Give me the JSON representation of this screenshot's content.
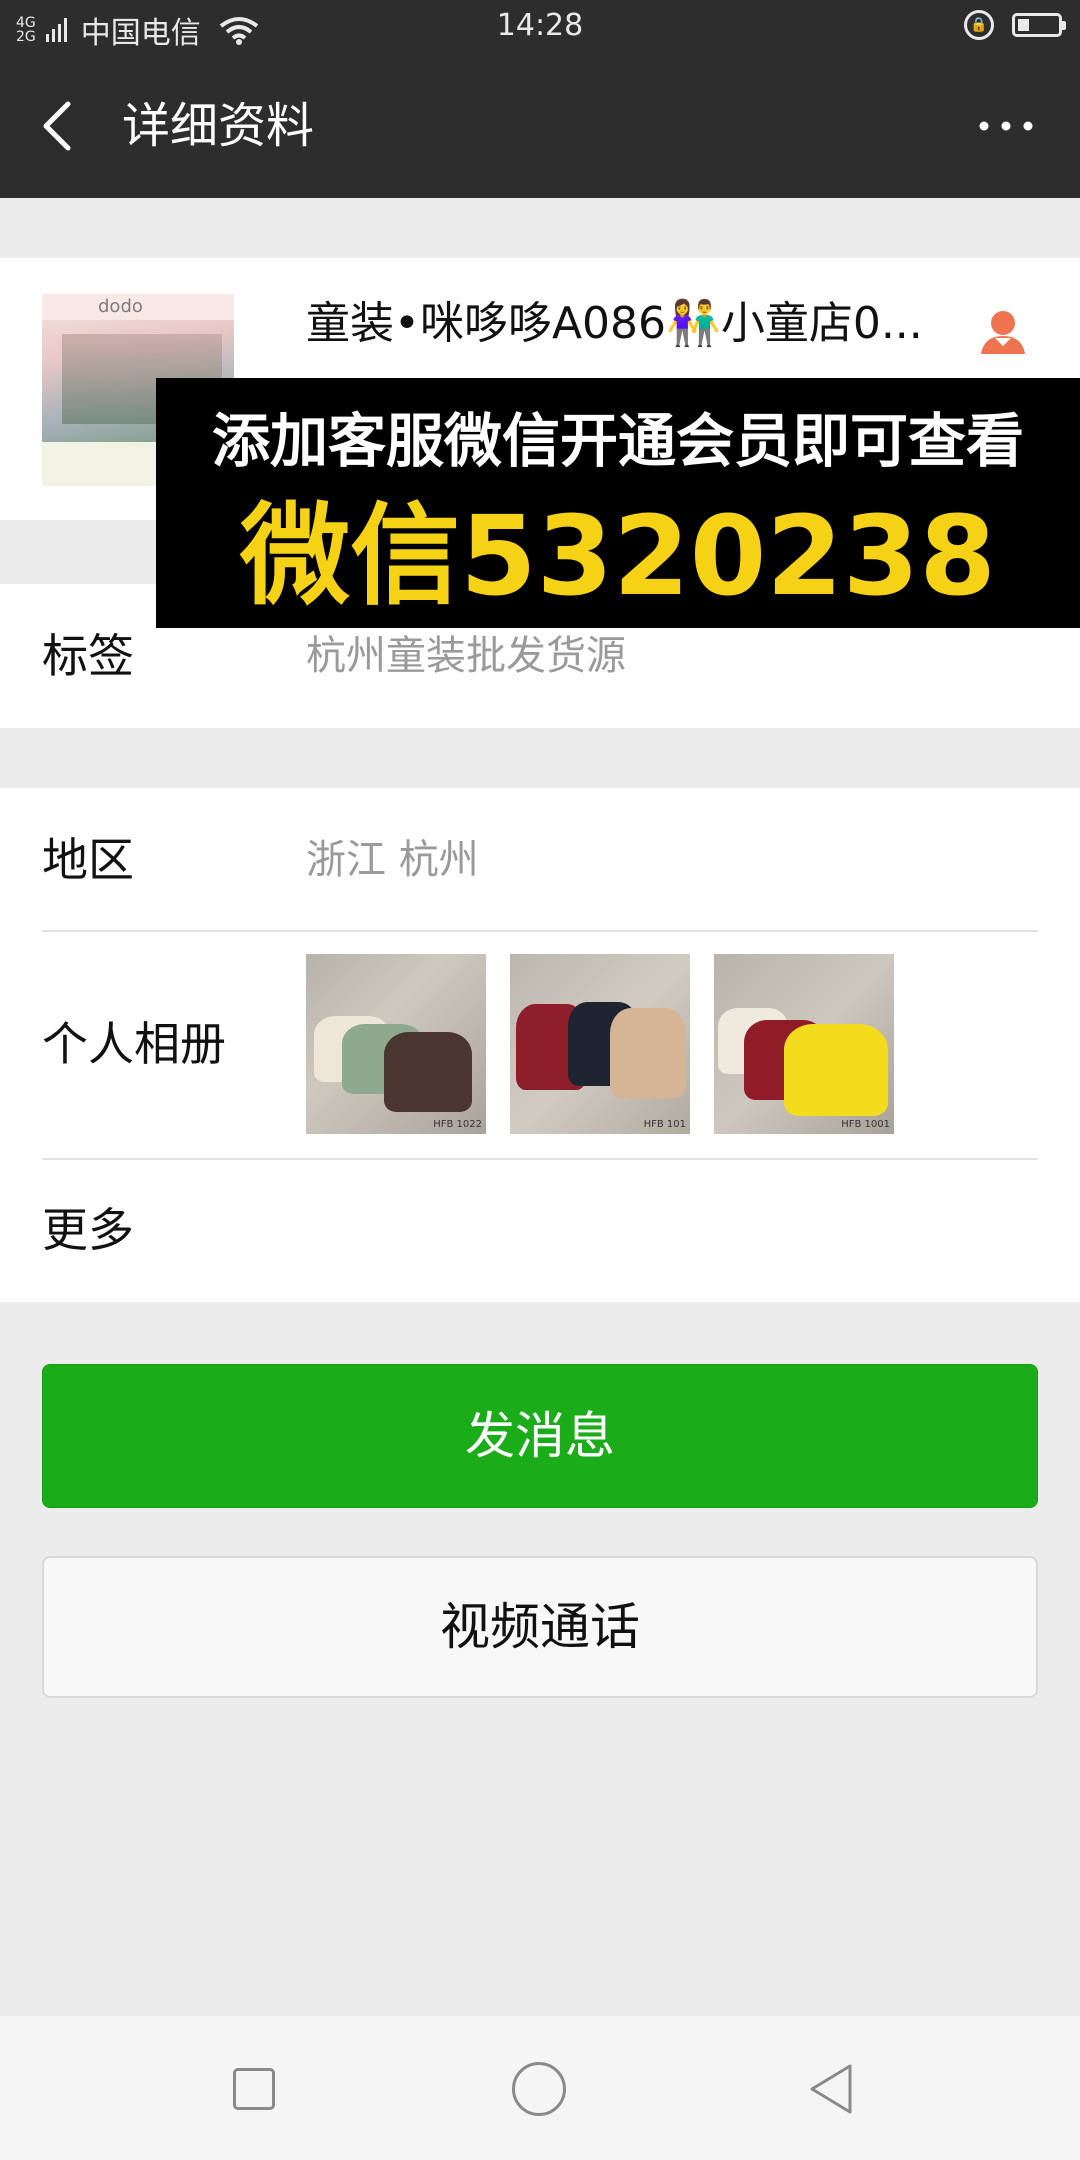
{
  "status_bar": {
    "network_top": "4G",
    "network_bottom": "2G",
    "carrier": "中国电信",
    "time": "14:28",
    "battery_level": 0.3
  },
  "nav": {
    "title": "详细资料",
    "back_icon": "chevron-left-icon",
    "more_icon": "more-dots-icon"
  },
  "profile": {
    "nickname": "童装•咪哆哆A086👫小童店0...",
    "avatar_text": "dodo",
    "contact_icon": "person-icon"
  },
  "overlay": {
    "line1": "添加客服微信开通会员即可查看",
    "line2": "微信5320238"
  },
  "tags": {
    "label": "标签",
    "value": "杭州童装批发货源"
  },
  "region": {
    "label": "地区",
    "value": "浙江  杭州"
  },
  "album": {
    "label": "个人相册",
    "photos": [
      {
        "caption": "HFB 1022"
      },
      {
        "caption": "HFB 101"
      },
      {
        "caption": "HFB 1001"
      }
    ]
  },
  "more": {
    "label": "更多"
  },
  "buttons": {
    "message": "发消息",
    "video_call": "视频通话"
  },
  "colors": {
    "header": "#2d2d2d",
    "primary_green": "#1aad19",
    "banner_yellow": "#f5d215",
    "contact_icon": "#f07350"
  }
}
